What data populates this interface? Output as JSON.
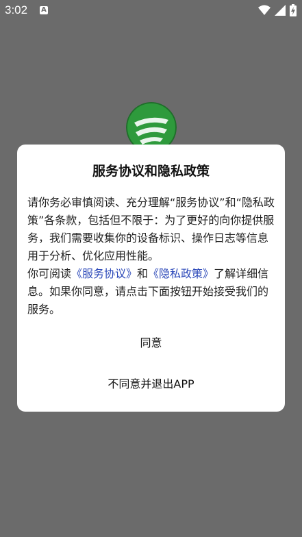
{
  "status_bar": {
    "time": "3:02",
    "notification_icon": "a-icon",
    "icons": [
      "wifi-icon",
      "signal-icon",
      "battery-icon"
    ]
  },
  "dialog": {
    "title": "服务协议和隐私政策",
    "paragraph1": "请你务必审慎阅读、充分理解“服务协议”和“隐私政策”各条款，包括但不限于：为了更好的向你提供服务，我们需要收集你的设备标识、操作日志等信息用于分析、优化应用性能。",
    "paragraph2_prefix": "你可阅读",
    "link_service": "《服务协议》",
    "paragraph2_and": "和",
    "link_privacy": "《隐私政策》",
    "paragraph2_suffix": "了解详细信息。如果你同意，请点击下面按钮开始接受我们的服务。",
    "agree_label": "同意",
    "disagree_label": "不同意并退出APP"
  },
  "colors": {
    "overlay": "#6b6b6b",
    "link": "#2a47b8",
    "logo_green": "#2e9a3c"
  }
}
